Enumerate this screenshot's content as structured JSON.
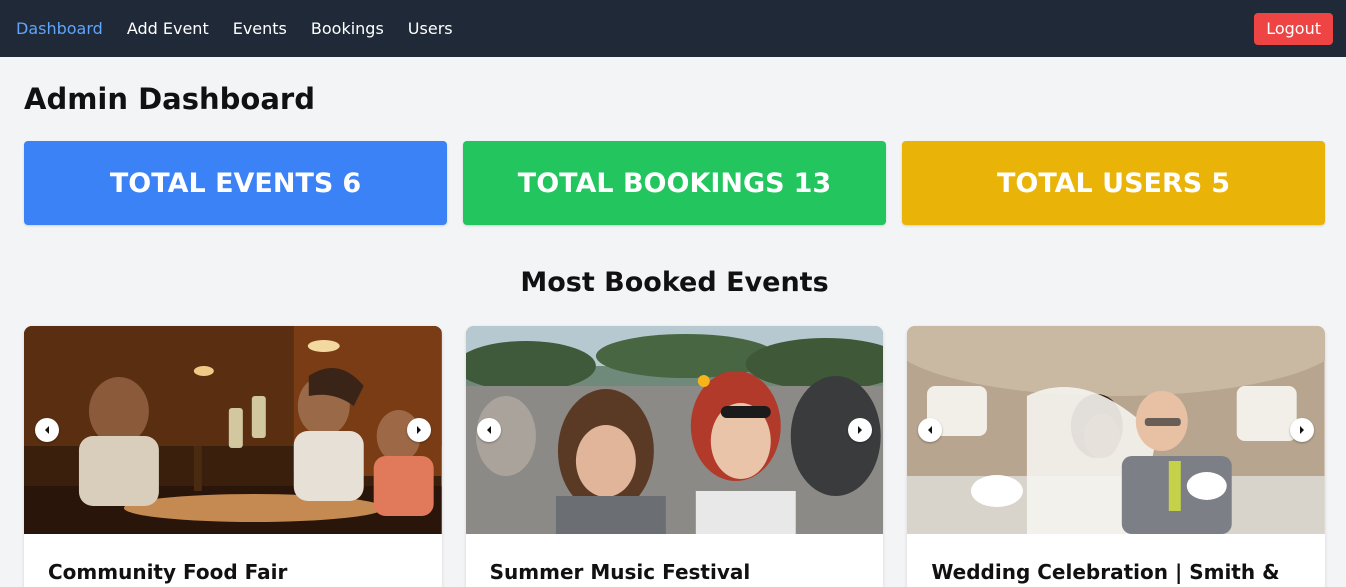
{
  "nav": {
    "links": [
      {
        "label": "Dashboard",
        "active": true
      },
      {
        "label": "Add Event",
        "active": false
      },
      {
        "label": "Events",
        "active": false
      },
      {
        "label": "Bookings",
        "active": false
      },
      {
        "label": "Users",
        "active": false
      }
    ],
    "logout_label": "Logout"
  },
  "page_title": "Admin Dashboard",
  "stats": [
    {
      "label": "TOTAL EVENTS",
      "value": "6",
      "color": "#3b82f6"
    },
    {
      "label": "TOTAL BOOKINGS",
      "value": "13",
      "color": "#22c55e"
    },
    {
      "label": "TOTAL USERS",
      "value": "5",
      "color": "#eab308"
    }
  ],
  "most_booked": {
    "title": "Most Booked Events",
    "events": [
      {
        "title": "Community Food Fair",
        "image_icon": "dinner-photo"
      },
      {
        "title": "Summer Music Festival",
        "image_icon": "festival-photo"
      },
      {
        "title": "Wedding Celebration | Smith &",
        "image_icon": "wedding-photo"
      }
    ]
  },
  "icons": {
    "prev": "chevron-left-icon",
    "next": "chevron-right-icon"
  },
  "colors": {
    "navbar": "#1f2937",
    "active_link": "#60a5fa",
    "logout": "#ef4444"
  }
}
